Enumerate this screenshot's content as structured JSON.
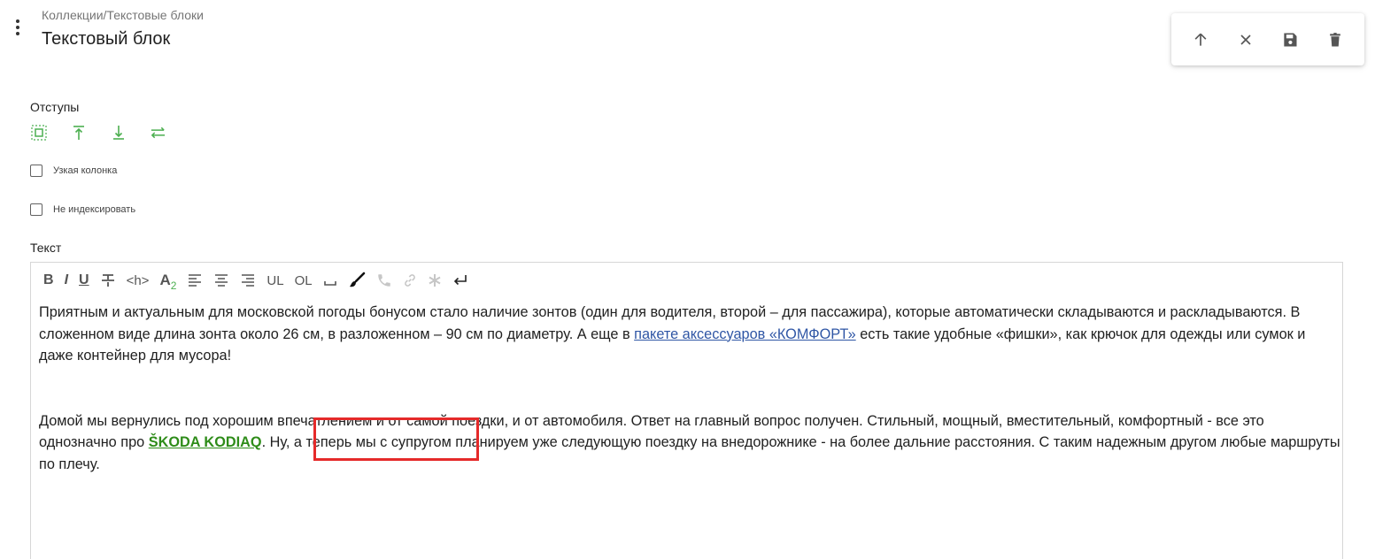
{
  "header": {
    "breadcrumb": "Коллекции/Текстовые блоки",
    "title": "Текстовый блок"
  },
  "actions": {
    "up_icon": "arrow-up-icon",
    "close_icon": "close-icon",
    "save_icon": "save-icon",
    "delete_icon": "trash-icon"
  },
  "indents": {
    "label": "Отступы",
    "icons": [
      "padding-all-icon",
      "padding-top-icon",
      "padding-bottom-icon",
      "padding-horizontal-icon"
    ],
    "accent_color": "#4caf50"
  },
  "options": {
    "narrow_column": {
      "label": "Узкая колонка",
      "checked": false
    },
    "no_index": {
      "label": "Не индексировать",
      "checked": false
    }
  },
  "text_section": {
    "label": "Текст",
    "toolbar": {
      "bold": "B",
      "italic": "I",
      "underline": "U",
      "strike": "S",
      "heading": "<h>",
      "subscript_a": "A",
      "subscript_2": "2",
      "ul": "UL",
      "ol": "OL"
    },
    "paragraph1": {
      "before_link": "Приятным и актуальным для московской погоды бонусом стало наличие зонтов (один для водителя, второй – для пассажира), которые автоматически складываются и раскладываются. В сложенном виде длина зонта около 26 см, в разложенном – 90 см по диаметру. А еще в ",
      "link": "пакете аксессуаров «КОМФОРТ»",
      "after_link": " есть такие удобные «фишки», как крючок для одежды или сумок и даже контейнер для мусора!"
    },
    "paragraph2": {
      "before_link": "Домой мы вернулись под хорошим впечатлением и от самой поездки, и от автомобиля. Ответ на главный вопрос получен. Стильный, мощный, вместительный, комфортный - все это однозначно про ",
      "link": "ŠKODA KODIAQ",
      "after_link": ". Ну, а теперь мы с супругом планируем уже следующую поездку на внедорожнике - на более дальние расстояния. С таким надежным другом любые маршруты по плечу."
    },
    "link_colors": {
      "blue": "#2f56a5",
      "green": "#2e8c19"
    },
    "highlight_color": "#e52a2a"
  }
}
